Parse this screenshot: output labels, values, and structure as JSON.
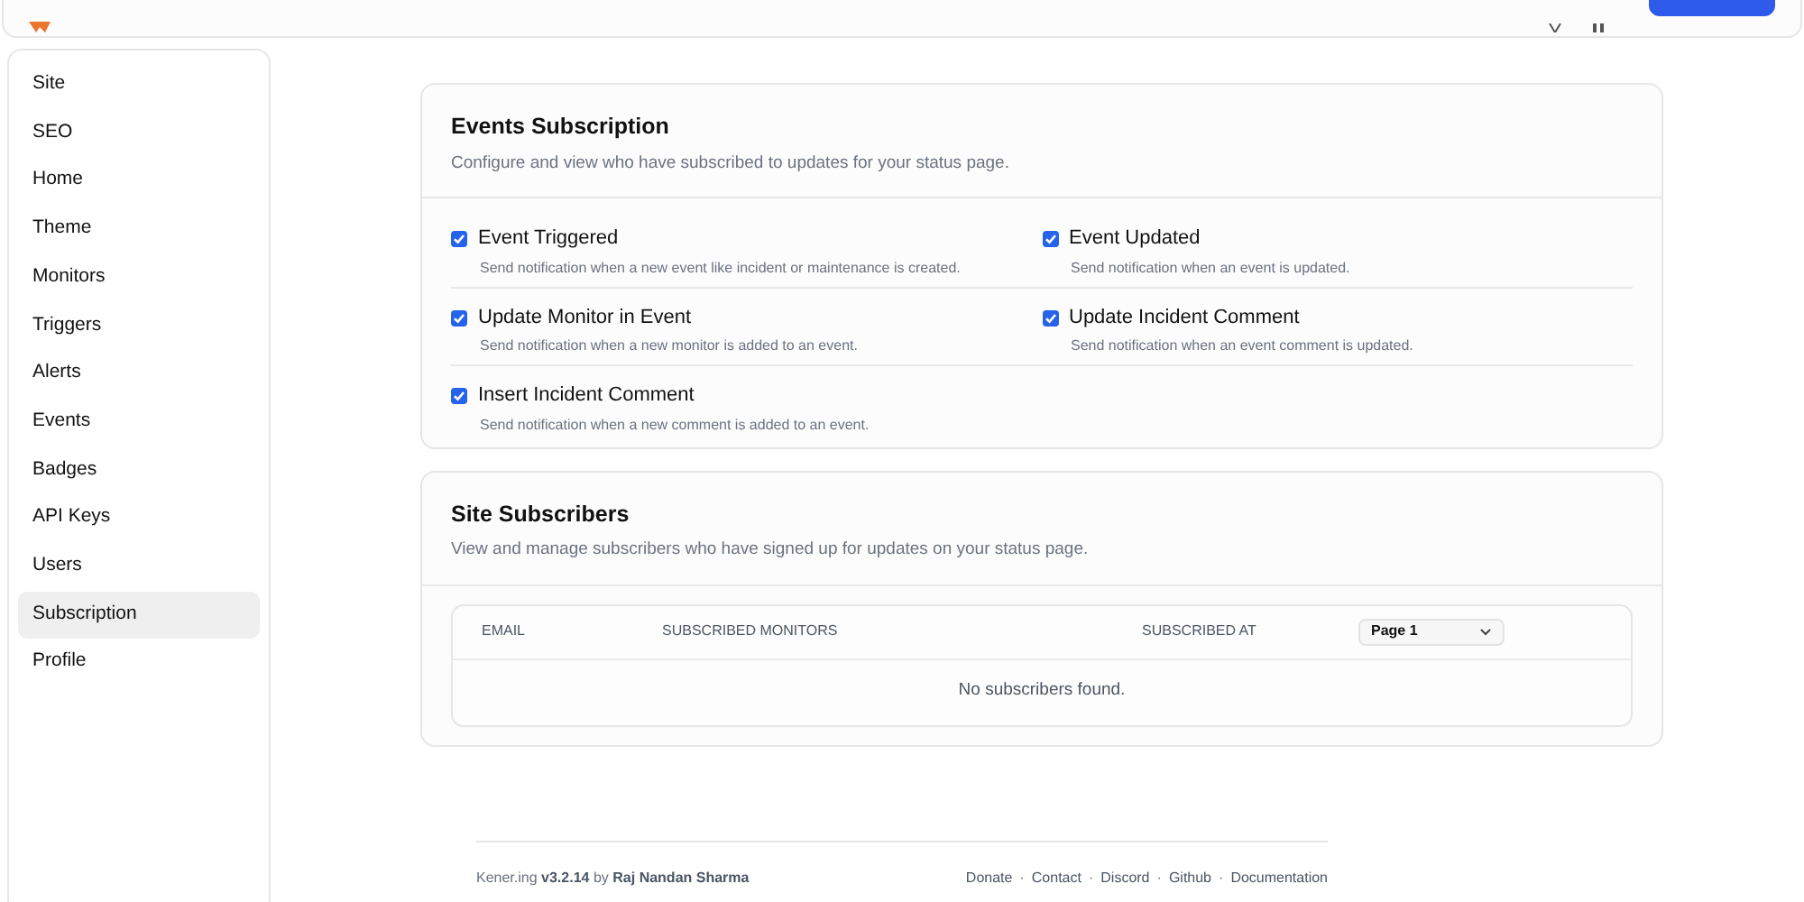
{
  "sidebar": {
    "items": [
      {
        "label": "Site",
        "selected": false
      },
      {
        "label": "SEO",
        "selected": false
      },
      {
        "label": "Home",
        "selected": false
      },
      {
        "label": "Theme",
        "selected": false
      },
      {
        "label": "Monitors",
        "selected": false
      },
      {
        "label": "Triggers",
        "selected": false
      },
      {
        "label": "Alerts",
        "selected": false
      },
      {
        "label": "Events",
        "selected": false
      },
      {
        "label": "Badges",
        "selected": false
      },
      {
        "label": "API Keys",
        "selected": false
      },
      {
        "label": "Users",
        "selected": false
      },
      {
        "label": "Subscription",
        "selected": true
      },
      {
        "label": "Profile",
        "selected": false
      }
    ]
  },
  "events_card": {
    "title": "Events Subscription",
    "description": "Configure and view who have subscribed to updates for your status page.",
    "options": [
      {
        "label": "Event Triggered",
        "hint": "Send notification when a new event like incident or maintenance is created.",
        "checked": true
      },
      {
        "label": "Event Updated",
        "hint": "Send notification when an event is updated.",
        "checked": true
      },
      {
        "label": "Update Monitor in Event",
        "hint": "Send notification when a new monitor is added to an event.",
        "checked": true
      },
      {
        "label": "Update Incident Comment",
        "hint": "Send notification when an event comment is updated.",
        "checked": true
      },
      {
        "label": "Insert Incident Comment",
        "hint": "Send notification when a new comment is added to an event.",
        "checked": true
      }
    ]
  },
  "subscribers_card": {
    "title": "Site Subscribers",
    "description": "View and manage subscribers who have signed up for updates on your status page.",
    "table": {
      "columns": [
        "EMAIL",
        "SUBSCRIBED MONITORS",
        "SUBSCRIBED AT"
      ],
      "page_select": "Page 1",
      "empty_message": "No subscribers found."
    }
  },
  "footer": {
    "credit": "Kener.ing **v3.2.14** by **Raj Nandan Sharma**",
    "separator": "·",
    "links": [
      "Donate",
      "Contact",
      "Discord",
      "Github",
      "Documentation"
    ]
  }
}
